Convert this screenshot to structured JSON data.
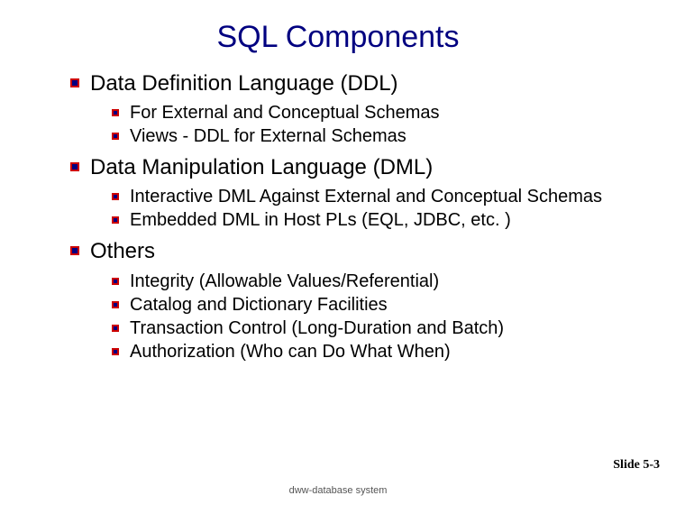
{
  "title": "SQL Components",
  "sections": [
    {
      "label": "Data Definition Language (DDL)",
      "items": [
        "For External and Conceptual Schemas",
        "Views - DDL for External Schemas"
      ]
    },
    {
      "label": "Data Manipulation Language (DML)",
      "items": [
        "Interactive DML Against External and Conceptual Schemas",
        "Embedded DML in Host PLs (EQL, JDBC, etc. )"
      ]
    },
    {
      "label": "Others",
      "items": [
        "Integrity (Allowable Values/Referential)",
        "Catalog and Dictionary Facilities",
        "Transaction Control (Long-Duration and Batch)",
        "Authorization (Who can Do What When)"
      ]
    }
  ],
  "slide_number": "Slide 5-3",
  "footer": "dww-database system"
}
